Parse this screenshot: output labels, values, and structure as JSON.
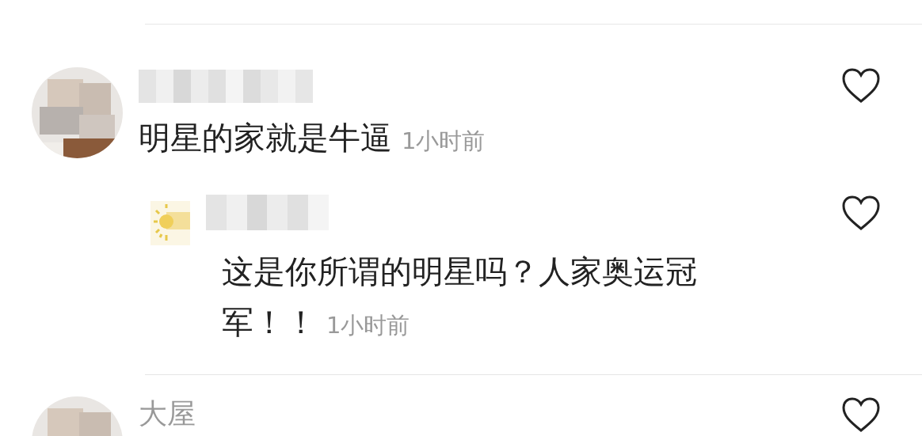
{
  "comments": [
    {
      "text": "明星的家就是牛逼",
      "time": "1小时前",
      "liked": false,
      "replies": [
        {
          "text": "这是你所谓的明星吗？人家奥运冠军！！",
          "time": "1小时前",
          "liked": false
        }
      ]
    },
    {
      "username": "大屋",
      "liked": false
    }
  ]
}
